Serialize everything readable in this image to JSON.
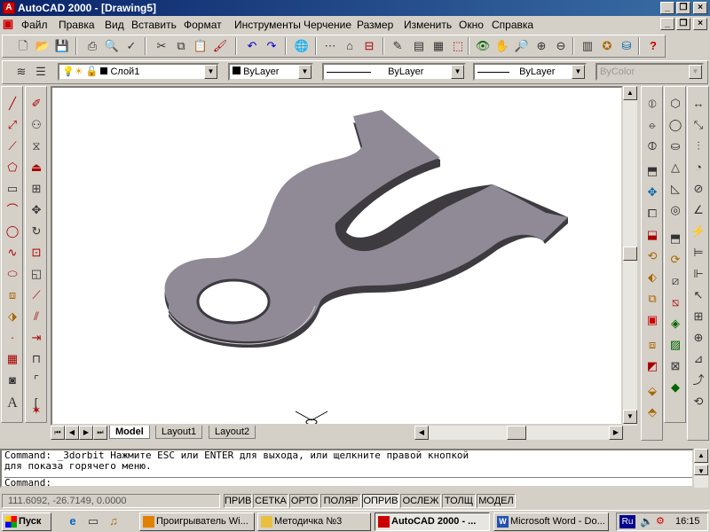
{
  "window": {
    "title": "AutoCAD 2000 - [Drawing5]",
    "app_icon_glyph": "A"
  },
  "menu": [
    "Файл",
    "Правка",
    "Вид",
    "Вставить",
    "Формат",
    "Инструменты",
    "Черчение",
    "Размер",
    "Изменить",
    "Окно",
    "Справка"
  ],
  "layers": {
    "layer_value": "Слой1",
    "color_value": "ByLayer",
    "linetype_value": "ByLayer",
    "lineweight_value": "ByLayer",
    "plotstyle_value": "ByColor"
  },
  "tabs": {
    "model": "Model",
    "layout1": "Layout1",
    "layout2": "Layout2"
  },
  "command": {
    "line1": "Command:  _3dorbit Нажмите ESC или ENTER для выхода, или щелкните правой кнопкой",
    "line2": "для показа горячего меню.",
    "prompt": "Command:"
  },
  "status": {
    "coords": "111.6092, -26.7149, 0.0000",
    "snap": "ПРИВ",
    "grid": "СЕТКА",
    "ortho": "ОРТО",
    "polar": "ПОЛЯР",
    "osnap": "ОПРИВ",
    "otrack": "ОСЛЕЖ",
    "lwt": "ТОЛЩ",
    "model": "МОДЕЛ"
  },
  "taskbar": {
    "start": "Пуск",
    "items": [
      "Проигрыватель Wi...",
      "Методичка №3",
      "AutoCAD 2000 - ...",
      "Microsoft Word - Do..."
    ],
    "lang": "Ru",
    "clock": "16:15"
  },
  "colors": {
    "title_start": "#0a246a",
    "title_end": "#3a6ea5",
    "part_fill": "#8f8a95",
    "part_edge": "#3d3a40"
  }
}
